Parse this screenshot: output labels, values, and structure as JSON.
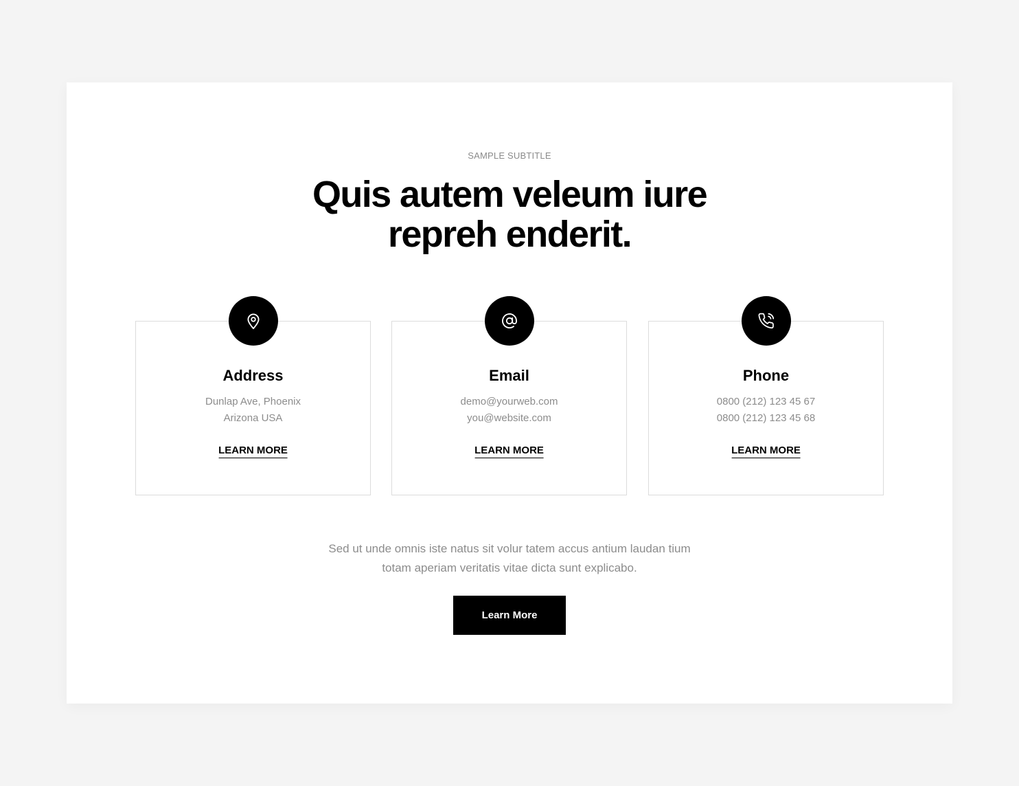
{
  "section": {
    "subtitle": "SAMPLE SUBTITLE",
    "heading_line_1": "Quis autem veleum iure",
    "heading_line_2": "repreh enderit."
  },
  "cards": [
    {
      "icon": "map-pin-icon",
      "title": "Address",
      "line_1": "Dunlap Ave, Phoenix",
      "line_2": "Arizona USA",
      "link_label": "LEARN MORE"
    },
    {
      "icon": "at-sign-icon",
      "title": "Email",
      "line_1": "demo@yourweb.com",
      "line_2": "you@website.com",
      "link_label": "LEARN MORE"
    },
    {
      "icon": "phone-call-icon",
      "title": "Phone",
      "line_1": "0800 (212) 123 45 67",
      "line_2": "0800 (212) 123 45 68",
      "link_label": "LEARN MORE"
    }
  ],
  "description": {
    "line_1": "Sed ut unde omnis iste natus sit volur tatem accus antium laudan tium",
    "line_2": "totam aperiam veritatis vitae dicta sunt explicabo."
  },
  "cta": {
    "label": "Learn More"
  },
  "colors": {
    "page_background": "#f4f4f4",
    "panel_background": "#ffffff",
    "accent": "#000000",
    "muted_text": "#8c8c8c",
    "card_border": "#dcdcdc"
  }
}
